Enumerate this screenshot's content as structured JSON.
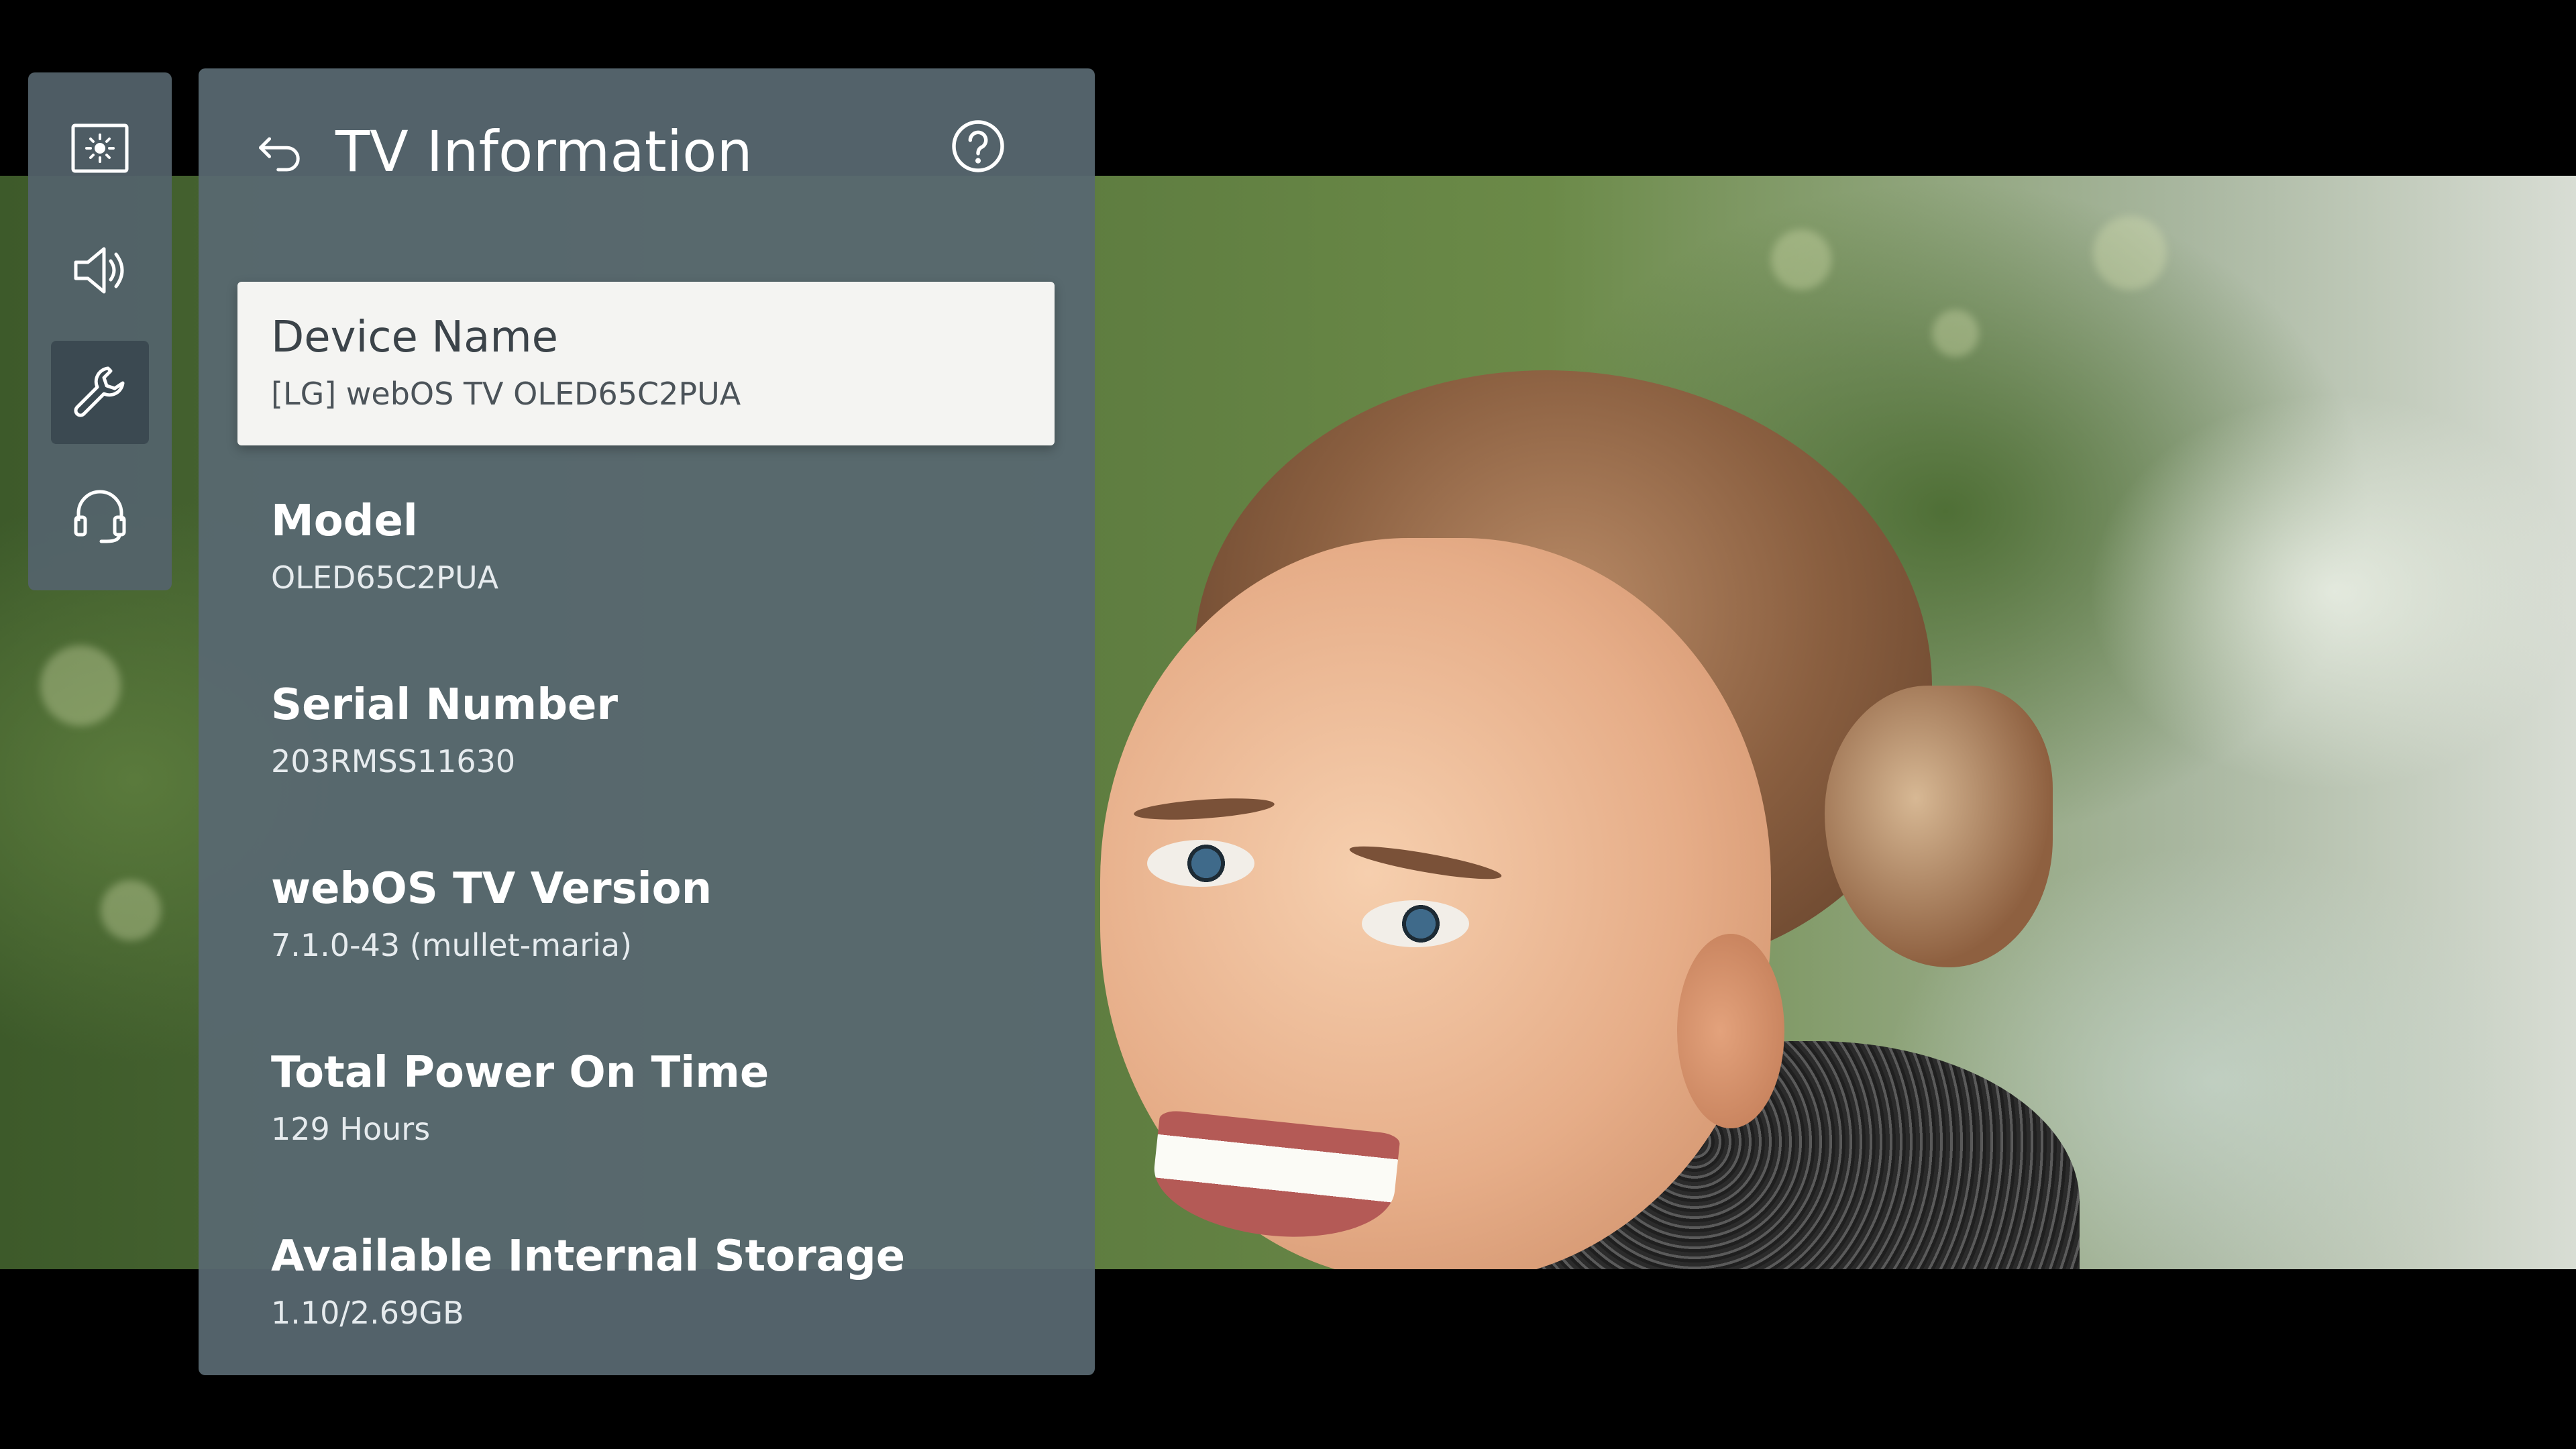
{
  "header": {
    "title": "TV Information"
  },
  "sidebar": {
    "items": [
      {
        "icon": "picture-icon",
        "active": false
      },
      {
        "icon": "sound-icon",
        "active": false
      },
      {
        "icon": "wrench-icon",
        "active": true
      },
      {
        "icon": "headset-icon",
        "active": false
      }
    ]
  },
  "info": {
    "items": [
      {
        "label": "Device Name",
        "value": "[LG] webOS TV OLED65C2PUA",
        "focused": true
      },
      {
        "label": "Model",
        "value": "OLED65C2PUA",
        "focused": false
      },
      {
        "label": "Serial Number",
        "value": "203RMSS11630",
        "focused": false
      },
      {
        "label": "webOS TV Version",
        "value": "7.1.0-43 (mullet-maria)",
        "focused": false
      },
      {
        "label": "Total Power On Time",
        "value": "129 Hours",
        "focused": false
      },
      {
        "label": "Available Internal Storage",
        "value": "1.10/2.69GB",
        "focused": false
      }
    ]
  },
  "colors": {
    "panel": "#586871",
    "rail": "#54636c",
    "focus": "#f4f4f2",
    "text": "#ffffff"
  }
}
